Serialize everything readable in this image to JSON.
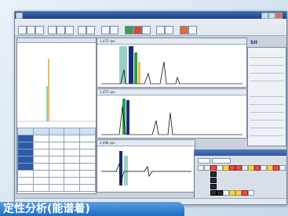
{
  "caption": "定性分析(能谱着)",
  "window": {
    "badge": "SII"
  },
  "spectra": [
    {
      "head_count": "1,472 cps"
    },
    {
      "head_count": "1,472 cps"
    },
    {
      "head_count": "2,096 cps"
    }
  ],
  "colors": {
    "accent_blue": "#1f6cc2",
    "peak_green": "#2a9c4e",
    "peak_navy": "#1a2d78",
    "element_red": "#e84d3f",
    "element_yellow": "#f7d34b"
  }
}
